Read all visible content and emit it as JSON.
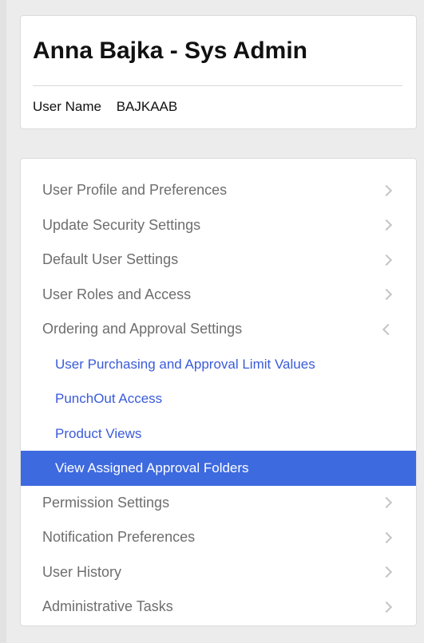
{
  "header": {
    "title": "Anna Bajka - Sys Admin",
    "username_label": "User Name",
    "username_value": "BAJKAAB"
  },
  "nav": {
    "items": [
      {
        "label": "User Profile and Preferences"
      },
      {
        "label": "Update Security Settings"
      },
      {
        "label": "Default User Settings"
      },
      {
        "label": "User Roles and Access"
      },
      {
        "label": "Ordering and Approval Settings"
      },
      {
        "label": "Permission Settings"
      },
      {
        "label": "Notification Preferences"
      },
      {
        "label": "User History"
      },
      {
        "label": "Administrative Tasks"
      }
    ],
    "subitems": [
      {
        "label": "User Purchasing and Approval Limit Values"
      },
      {
        "label": "PunchOut Access"
      },
      {
        "label": "Product Views"
      },
      {
        "label": "View Assigned Approval Folders"
      }
    ]
  },
  "colors": {
    "link": "#3a5bd9",
    "active_bg": "#3e6ae0"
  }
}
